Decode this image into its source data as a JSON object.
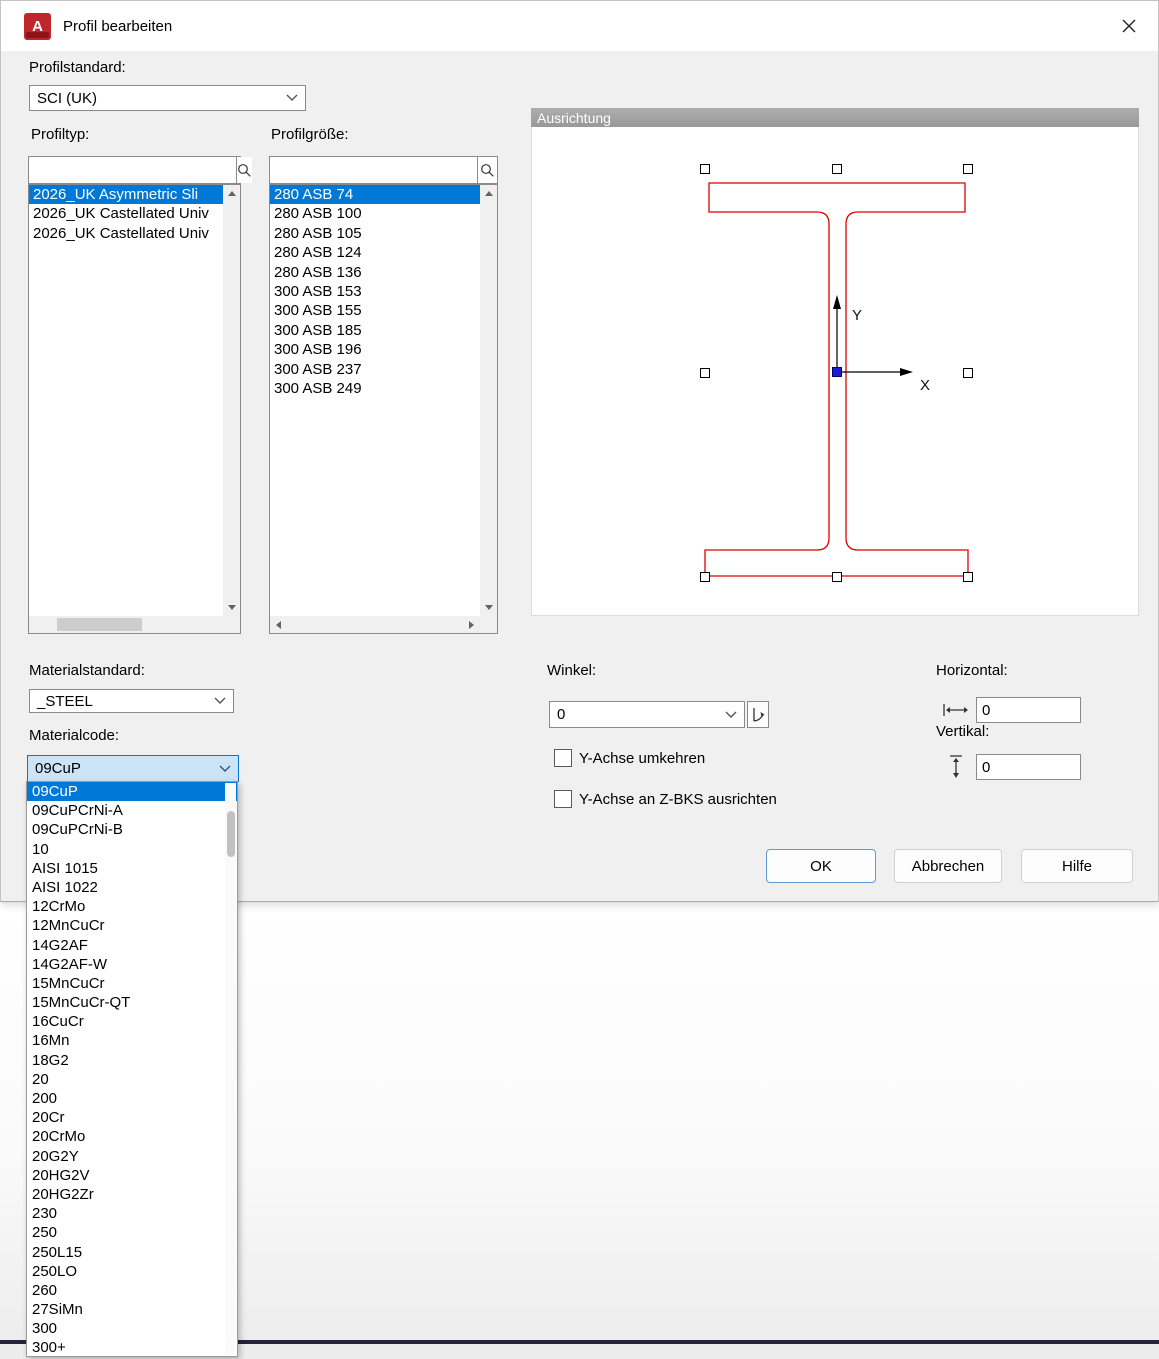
{
  "window": {
    "title": "Profil bearbeiten",
    "app_icon_letter": "A"
  },
  "profile_standard": {
    "label": "Profilstandard:",
    "value": "SCI (UK)"
  },
  "profile_type": {
    "label": "Profiltyp:",
    "search_value": "",
    "items": [
      "2026_UK Asymmetric Sli",
      "2026_UK Castellated Univ",
      "2026_UK Castellated Univ"
    ]
  },
  "profile_size": {
    "label": "Profilgröße:",
    "search_value": "",
    "items": [
      "280 ASB 74",
      "280 ASB 100",
      "280 ASB 105",
      "280 ASB 124",
      "280 ASB 136",
      "300 ASB 153",
      "300 ASB 155",
      "300 ASB 185",
      "300 ASB 196",
      "300 ASB 237",
      "300 ASB 249"
    ]
  },
  "preview": {
    "header": "Ausrichtung",
    "axis_x": "X",
    "axis_y": "Y",
    "outline_color": "#dd0000"
  },
  "material_standard": {
    "label": "Materialstandard:",
    "value": "_STEEL"
  },
  "material_code": {
    "label": "Materialcode:",
    "value": "09CuP",
    "options": [
      "09CuP",
      "09CuPCrNi-A",
      "09CuPCrNi-B",
      "10",
      "AISI 1015",
      "AISI 1022",
      "12CrMo",
      "12MnCuCr",
      "14G2AF",
      "14G2AF-W",
      "15MnCuCr",
      "15MnCuCr-QT",
      "16CuCr",
      "16Mn",
      "18G2",
      "20",
      "200",
      "20Cr",
      "20CrMo",
      "20G2Y",
      "20HG2V",
      "20HG2Zr",
      "230",
      "250",
      "250L15",
      "250LO",
      "260",
      "27SiMn",
      "300",
      "300+"
    ]
  },
  "angle": {
    "label": "Winkel:",
    "value": "0"
  },
  "options": {
    "invert_y_label": "Y-Achse umkehren",
    "align_zbks_label": "Y-Achse an Z-BKS ausrichten"
  },
  "horizontal": {
    "label": "Horizontal:",
    "value": "0"
  },
  "vertical": {
    "label": "Vertikal:",
    "value": "0"
  },
  "buttons": {
    "ok": "OK",
    "cancel": "Abbrechen",
    "help": "Hilfe"
  }
}
